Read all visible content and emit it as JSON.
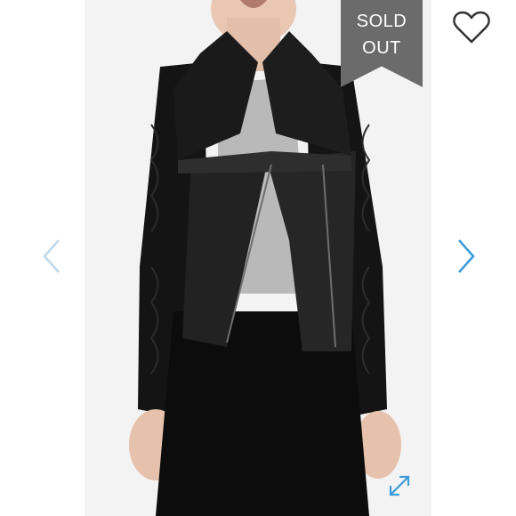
{
  "badge": {
    "line1": "SOLD",
    "line2": "OUT"
  },
  "colors": {
    "badge_bg": "#6b6b6b",
    "accent_arrow": "#3a9bd9",
    "inactive_arrow": "#bcd8ec",
    "heart_outline": "#333333"
  },
  "icons": {
    "favorite": "heart-outline-icon",
    "previous": "chevron-left-icon",
    "next": "chevron-right-icon",
    "expand": "expand-arrows-icon"
  }
}
